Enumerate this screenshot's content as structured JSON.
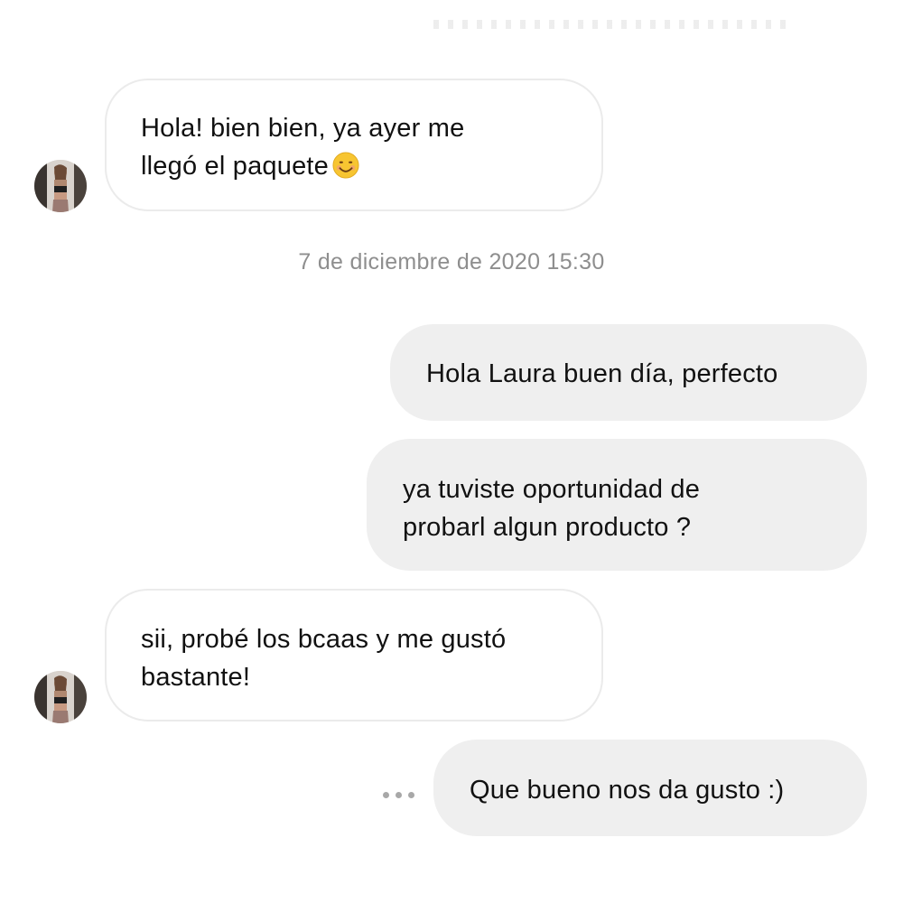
{
  "conversation": {
    "messages": [
      {
        "sender": "contact",
        "lines": [
          "Hola! bien bien, ya ayer me",
          "llegó el paquete"
        ],
        "emoji": "smiling-face-emoji"
      },
      {
        "sender": "me",
        "lines": [
          "Hola Laura buen día, perfecto"
        ]
      },
      {
        "sender": "me",
        "lines": [
          "ya tuviste oportunidad de",
          "probarl algun producto ?"
        ]
      },
      {
        "sender": "contact",
        "lines": [
          "sii, probé los bcaas y me gustó",
          "bastante!"
        ]
      },
      {
        "sender": "me",
        "lines": [
          "Que bueno nos da gusto :)"
        ]
      }
    ],
    "timestamp": "7 de diciembre de 2020 15:30",
    "typing_indicator": "typing-dots-icon"
  },
  "colors": {
    "background": "#ffffff",
    "incoming_bubble": "#ffffff",
    "incoming_border": "#ebebeb",
    "outgoing_bubble": "#efefef",
    "timestamp_text": "#8e8e8e",
    "emoji": "#f7c531"
  }
}
